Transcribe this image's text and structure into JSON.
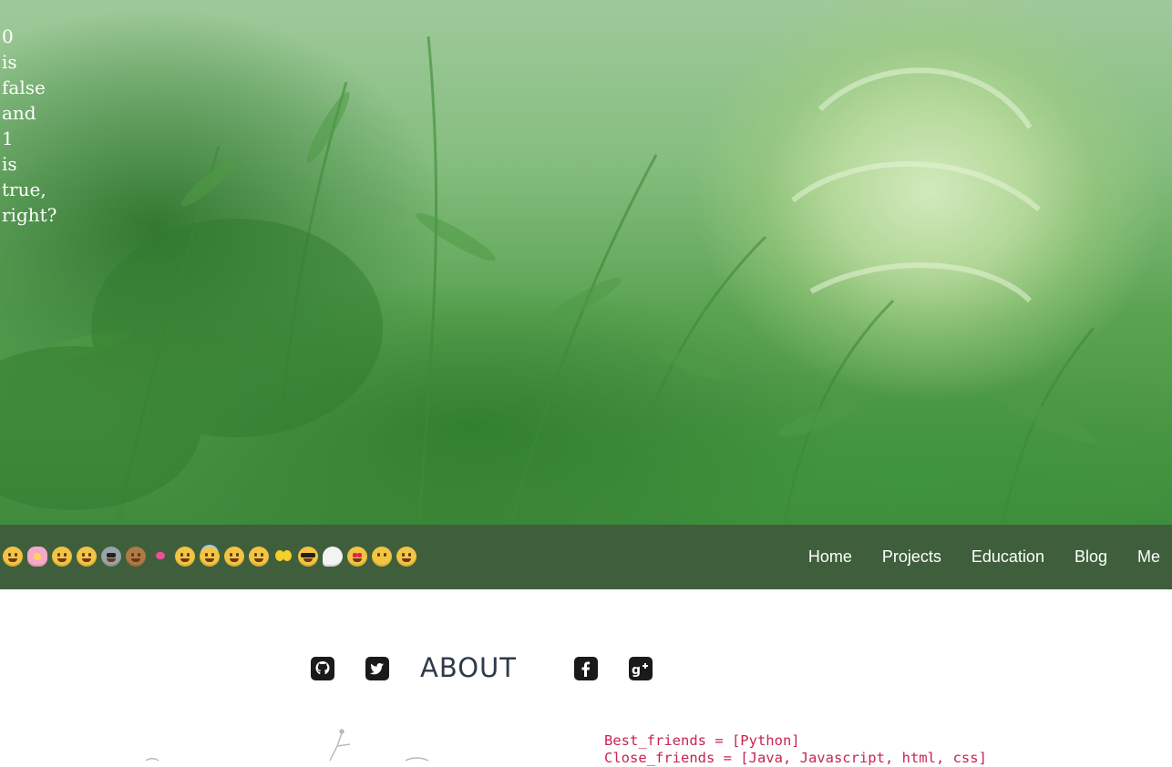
{
  "hero": {
    "quote_words": [
      "0",
      "is",
      "false",
      "and",
      "1",
      "is",
      "true,",
      "right?"
    ]
  },
  "nav": {
    "emojis": [
      {
        "icon": "tears-of-joy-icon",
        "style": ""
      },
      {
        "icon": "cherry-blossom-icon",
        "style": "flower"
      },
      {
        "icon": "kissing-face-icon",
        "style": ""
      },
      {
        "icon": "worried-face-icon",
        "style": ""
      },
      {
        "icon": "alien-icon",
        "style": "alien"
      },
      {
        "icon": "see-no-evil-monkey-icon",
        "style": "monkey"
      },
      {
        "icon": "two-hearts-icon",
        "style": "hearts"
      },
      {
        "icon": "smiling-face-icon",
        "style": ""
      },
      {
        "icon": "halo-face-icon",
        "style": "halo"
      },
      {
        "icon": "relieved-face-icon",
        "style": ""
      },
      {
        "icon": "tongue-wink-face-icon",
        "style": ""
      },
      {
        "icon": "yellow-heart-icon",
        "style": "yheart"
      },
      {
        "icon": "sunglasses-face-icon",
        "style": "cool"
      },
      {
        "icon": "thought-bubble-icon",
        "style": "bubble"
      },
      {
        "icon": "heart-eyes-face-icon",
        "style": "love"
      },
      {
        "icon": "no-mouth-face-icon",
        "style": "nomouth"
      },
      {
        "icon": "sweat-smile-face-icon",
        "style": ""
      }
    ],
    "links": [
      "Home",
      "Projects",
      "Education",
      "Blog",
      "Me"
    ]
  },
  "about": {
    "title": "ABOUT",
    "social_icons": [
      "github-icon",
      "twitter-icon",
      "facebook-icon",
      "google-plus-icon"
    ],
    "code_lines": [
      "Best_friends = [Python]",
      "Close_friends = [Java, Javascript, html, css]"
    ]
  },
  "colors": {
    "nav_bg": "#3f5f3c",
    "code_text": "#c7254e",
    "title_text": "#2e3a4a",
    "hero_tint": "#86be80"
  }
}
